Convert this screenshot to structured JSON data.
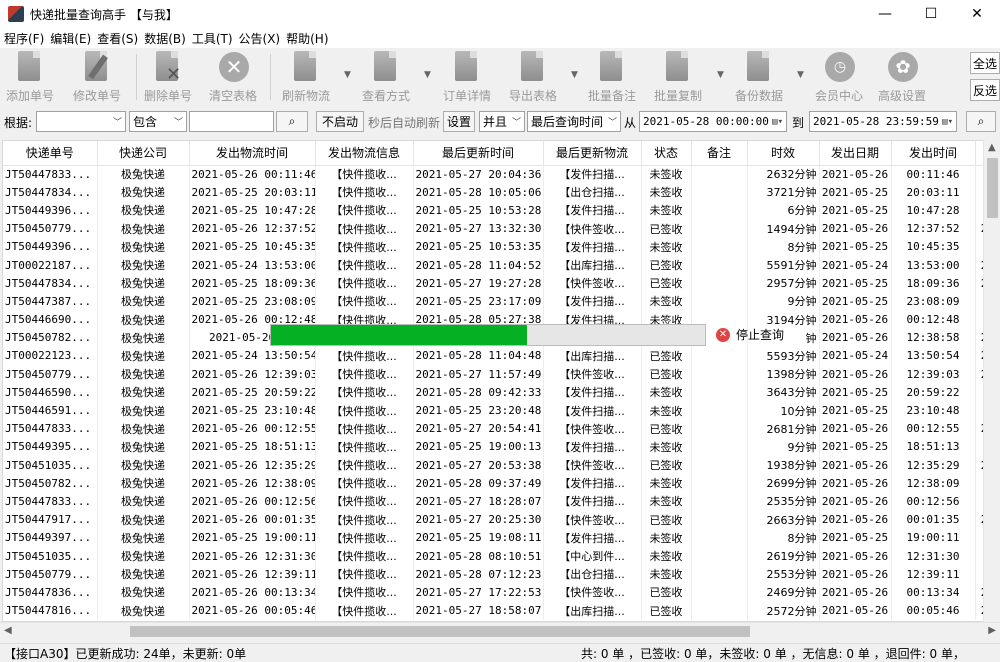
{
  "window": {
    "title": "快递批量查询高手 【与我】",
    "minimize": "—",
    "maximize": "☐",
    "close": "✕"
  },
  "menu": [
    "程序(F)",
    "编辑(E)",
    "查看(S)",
    "数据(B)",
    "工具(T)",
    "公告(X)",
    "帮助(H)"
  ],
  "toolbar": {
    "add": "添加单号",
    "edit": "修改单号",
    "delete": "删除单号",
    "clear": "清空表格",
    "refresh": "刷新物流",
    "view": "查看方式",
    "detail": "订单详情",
    "export": "导出表格",
    "batch_note": "批量备注",
    "batch_copy": "批量复制",
    "backup": "备份数据",
    "member": "会员中心",
    "advanced": "高级设置",
    "select_all": "全选",
    "invert": "反选"
  },
  "filter": {
    "label": "根据:",
    "field_value": "",
    "match": "包含",
    "search_value": "",
    "auto_refresh": "不启动",
    "auto_refresh_text": "秒后自动刷新",
    "settings": "设置",
    "logic": "并且",
    "time_field": "最后查询时间",
    "from_label": "从",
    "from": "2021-05-28 00:00:00",
    "to_label": "到",
    "to": "2021-05-28 23:59:59"
  },
  "table": {
    "headers": [
      "快递单号",
      "快递公司",
      "发出物流时间",
      "发出物流信息",
      "最后更新时间",
      "最后更新物流",
      "状态",
      "备注",
      "时效",
      "发出日期",
      "发出时间",
      ""
    ],
    "rows": [
      [
        "JT50447833...",
        "极兔快递",
        "2021-05-26 00:11:46",
        "【快件揽收...",
        "2021-05-27 20:04:36",
        "【发件扫描...",
        "未签收",
        "",
        "2632分钟",
        "2021-05-26",
        "00:11:46",
        ""
      ],
      [
        "JT50447834...",
        "极兔快递",
        "2021-05-25 20:03:11",
        "【快件揽收...",
        "2021-05-28 10:05:06",
        "【出仓扫描...",
        "未签收",
        "",
        "3721分钟",
        "2021-05-25",
        "20:03:11",
        ""
      ],
      [
        "JT50449396...",
        "极兔快递",
        "2021-05-25 10:47:28",
        "【快件揽收...",
        "2021-05-25 10:53:28",
        "【发件扫描...",
        "未签收",
        "",
        "6分钟",
        "2021-05-25",
        "10:47:28",
        ""
      ],
      [
        "JT50450779...",
        "极兔快递",
        "2021-05-26 12:37:52",
        "【快件揽收...",
        "2021-05-27 13:32:30",
        "【快件签收...",
        "已签收",
        "",
        "1494分钟",
        "2021-05-26",
        "12:37:52",
        "2"
      ],
      [
        "JT50449396...",
        "极兔快递",
        "2021-05-25 10:45:35",
        "【快件揽收...",
        "2021-05-25 10:53:35",
        "【发件扫描...",
        "未签收",
        "",
        "8分钟",
        "2021-05-25",
        "10:45:35",
        ""
      ],
      [
        "JT00022187...",
        "极兔快递",
        "2021-05-24 13:53:00",
        "【快件揽收...",
        "2021-05-28 11:04:52",
        "【出库扫描...",
        "已签收",
        "",
        "5591分钟",
        "2021-05-24",
        "13:53:00",
        "2"
      ],
      [
        "JT50447834...",
        "极兔快递",
        "2021-05-25 18:09:36",
        "【快件揽收...",
        "2021-05-27 19:27:28",
        "【快件签收...",
        "已签收",
        "",
        "2957分钟",
        "2021-05-25",
        "18:09:36",
        "2"
      ],
      [
        "JT50447387...",
        "极兔快递",
        "2021-05-25 23:08:09",
        "【快件揽收...",
        "2021-05-25 23:17:09",
        "【发件扫描...",
        "未签收",
        "",
        "9分钟",
        "2021-05-25",
        "23:08:09",
        ""
      ],
      [
        "JT50446690...",
        "极兔快递",
        "2021-05-26 00:12:48",
        "【快件揽收...",
        "2021-05-28 05:27:38",
        "【发件扫描...",
        "未签收",
        "",
        "3194分钟",
        "2021-05-26",
        "00:12:48",
        ""
      ],
      [
        "JT50450782...",
        "极兔快递",
        "2021-05-26 12",
        "",
        "",
        "",
        "",
        "",
        "钟",
        "2021-05-26",
        "12:38:58",
        "2"
      ],
      [
        "JT00022123...",
        "极兔快递",
        "2021-05-24 13:50:54",
        "【快件揽收...",
        "2021-05-28 11:04:48",
        "【出库扫描...",
        "已签收",
        "",
        "5593分钟",
        "2021-05-24",
        "13:50:54",
        "2"
      ],
      [
        "JT50450779...",
        "极兔快递",
        "2021-05-26 12:39:03",
        "【快件揽收...",
        "2021-05-27 11:57:49",
        "【快件签收...",
        "已签收",
        "",
        "1398分钟",
        "2021-05-26",
        "12:39:03",
        "2"
      ],
      [
        "JT50446590...",
        "极兔快递",
        "2021-05-25 20:59:22",
        "【快件揽收...",
        "2021-05-28 09:42:33",
        "【发件扫描...",
        "未签收",
        "",
        "3643分钟",
        "2021-05-25",
        "20:59:22",
        ""
      ],
      [
        "JT50446591...",
        "极兔快递",
        "2021-05-25 23:10:48",
        "【快件揽收...",
        "2021-05-25 23:20:48",
        "【发件扫描...",
        "未签收",
        "",
        "10分钟",
        "2021-05-25",
        "23:10:48",
        ""
      ],
      [
        "JT50447833...",
        "极兔快递",
        "2021-05-26 00:12:55",
        "【快件揽收...",
        "2021-05-27 20:54:41",
        "【快件签收...",
        "已签收",
        "",
        "2681分钟",
        "2021-05-26",
        "00:12:55",
        "2"
      ],
      [
        "JT50449395...",
        "极兔快递",
        "2021-05-25 18:51:13",
        "【快件揽收...",
        "2021-05-25 19:00:13",
        "【发件扫描...",
        "未签收",
        "",
        "9分钟",
        "2021-05-25",
        "18:51:13",
        ""
      ],
      [
        "JT50451035...",
        "极兔快递",
        "2021-05-26 12:35:29",
        "【快件揽收...",
        "2021-05-27 20:53:38",
        "【快件签收...",
        "已签收",
        "",
        "1938分钟",
        "2021-05-26",
        "12:35:29",
        "2"
      ],
      [
        "JT50450782...",
        "极兔快递",
        "2021-05-26 12:38:09",
        "【快件揽收...",
        "2021-05-28 09:37:49",
        "【发件扫描...",
        "未签收",
        "",
        "2699分钟",
        "2021-05-26",
        "12:38:09",
        ""
      ],
      [
        "JT50447833...",
        "极兔快递",
        "2021-05-26 00:12:56",
        "【快件揽收...",
        "2021-05-27 18:28:07",
        "【发件扫描...",
        "未签收",
        "",
        "2535分钟",
        "2021-05-26",
        "00:12:56",
        ""
      ],
      [
        "JT50447917...",
        "极兔快递",
        "2021-05-26 00:01:35",
        "【快件揽收...",
        "2021-05-27 20:25:30",
        "【快件签收...",
        "已签收",
        "",
        "2663分钟",
        "2021-05-26",
        "00:01:35",
        "2"
      ],
      [
        "JT50449397...",
        "极兔快递",
        "2021-05-25 19:00:11",
        "【快件揽收...",
        "2021-05-25 19:08:11",
        "【发件扫描...",
        "未签收",
        "",
        "8分钟",
        "2021-05-25",
        "19:00:11",
        ""
      ],
      [
        "JT50451035...",
        "极兔快递",
        "2021-05-26 12:31:30",
        "【快件揽收...",
        "2021-05-28 08:10:51",
        "【中心到件...",
        "未签收",
        "",
        "2619分钟",
        "2021-05-26",
        "12:31:30",
        ""
      ],
      [
        "JT50450779...",
        "极兔快递",
        "2021-05-26 12:39:11",
        "【快件揽收...",
        "2021-05-28 07:12:23",
        "【出仓扫描...",
        "未签收",
        "",
        "2553分钟",
        "2021-05-26",
        "12:39:11",
        ""
      ],
      [
        "JT50447836...",
        "极兔快递",
        "2021-05-26 00:13:34",
        "【快件揽收...",
        "2021-05-27 17:22:53",
        "【快件签收...",
        "已签收",
        "",
        "2469分钟",
        "2021-05-26",
        "00:13:34",
        "2"
      ],
      [
        "JT50447816...",
        "极兔快递",
        "2021-05-26 00:05:46",
        "【快件揽收...",
        "2021-05-27 18:58:07",
        "【出库扫描...",
        "已签收",
        "",
        "2572分钟",
        "2021-05-26",
        "00:05:46",
        "2"
      ]
    ]
  },
  "progress": {
    "fraction": 0.59,
    "stop_label": "停止查询"
  },
  "status": {
    "left": "【接口A30】已更新成功: 24单，未更新: 0单",
    "right": "共: 0 单 ，已签收:  0 单，未签收:  0 单 ，无信息: 0 单 ，退回件: 0 单，"
  },
  "colors": {
    "progress_fill": "#06b025",
    "stop_icon": "#e04343"
  }
}
